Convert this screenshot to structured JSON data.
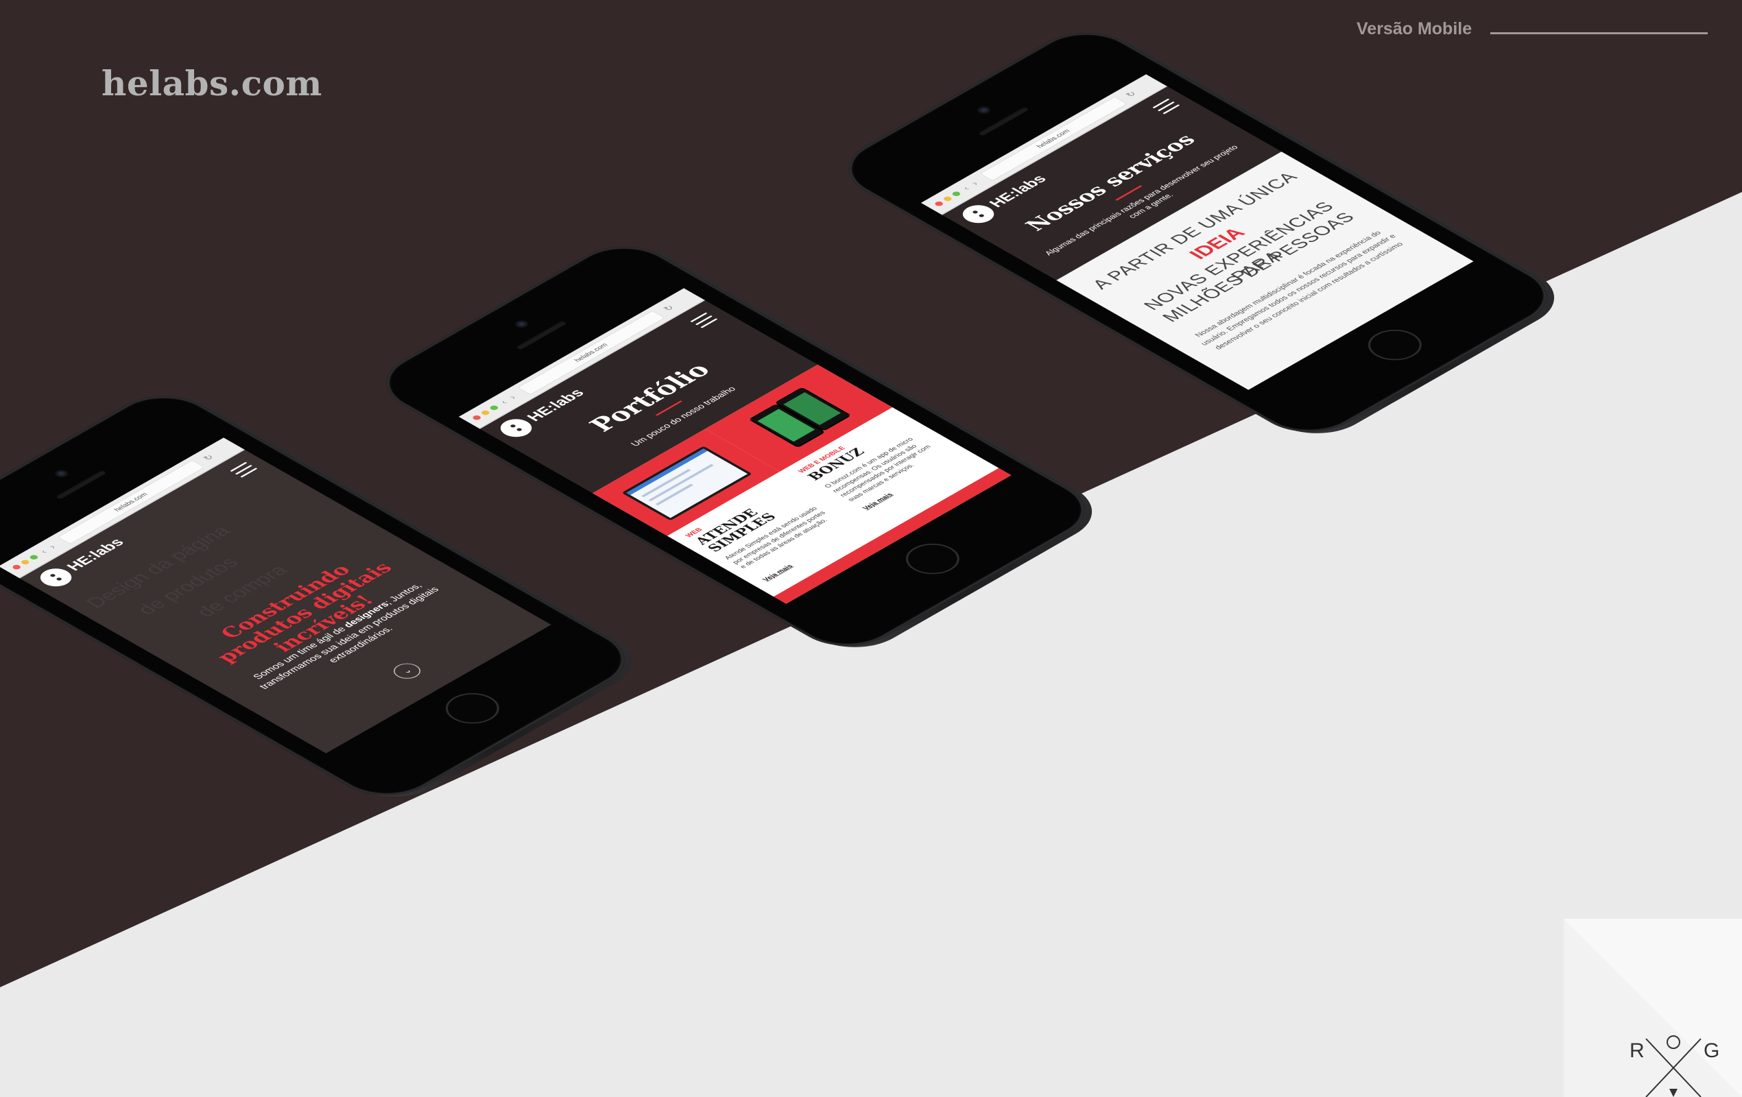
{
  "page": {
    "brand": "helabs.com",
    "section_label": "Versão Mobile",
    "colors": {
      "dark_band": "#352828",
      "light_band": "#eaeaeb",
      "accent_red": "#e8323b",
      "brand_gray": "#b3b3b3"
    }
  },
  "browser": {
    "url": "helabs.com"
  },
  "site_logo": "HE:labs",
  "phones": [
    {
      "id": "home",
      "hero_title": "Construindo produtos digitais incríveis!",
      "hero_text_before": "Somos um time ágil de ",
      "hero_text_strong": "designers",
      "hero_text_after": "; Juntos, transformamos sua ideia em produtos digitais extraordinários.",
      "scroll_icon": "chevron-down-icon"
    },
    {
      "id": "portfolio",
      "title": "Portfólio",
      "subtitle": "Um pouco do nosso trabalho",
      "cards": [
        {
          "tag": "WEB",
          "title": "ATENDE SIMPLES",
          "text": "Atende Simples está sendo usado por empresas de diferentes portes e de todas as áreas de atuação.",
          "link": "Veja mais"
        },
        {
          "tag": "WEB E MOBILE",
          "title": "BONUZ",
          "text": "O bonuz.com é um app de micro recompensas. Os usuários são recompensados por interagir com suas marcas e serviços.",
          "link": "Veja mais"
        }
      ]
    },
    {
      "id": "services",
      "title": "Nossos serviços",
      "subtitle": "Algumas das principais razões para desenvolver seu projeto com a gente.",
      "line1": "A PARTIR DE UMA ÚNICA",
      "highlight": "IDEIA",
      "line2": "NOVAS EXPERIÊNCIAS PARA",
      "line3": "MILHÕES DE PESSOAS",
      "text": "Nossa abordagem multidisciplinar é focada na experiência do usuário. Empregamos todos os nossos recursos para expandir e desenvolver o seu conceito inicial com resultados a curtíssimo"
    }
  ],
  "signature": {
    "left_letter": "R",
    "right_letter": "G"
  }
}
